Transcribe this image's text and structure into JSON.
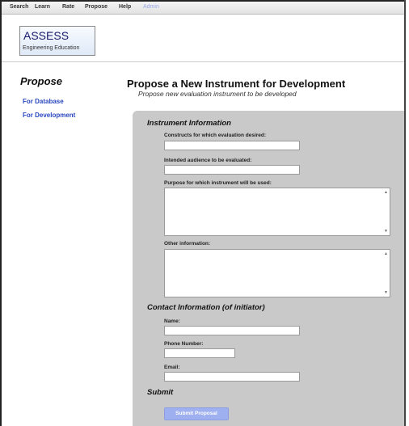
{
  "topnav": {
    "items": [
      "Search",
      "Learn",
      "Rate",
      "Propose",
      "Help"
    ],
    "admin": "Admin"
  },
  "logo": {
    "line1": "ASSESS",
    "line2": "Engineering Education"
  },
  "sidebar": {
    "title": "Propose",
    "links": [
      "For Database",
      "For Development"
    ]
  },
  "main": {
    "title": "Propose a New Instrument for Development",
    "subtitle": "Propose new evaluation instrument to be developed"
  },
  "form": {
    "instrument_section": "Instrument Information",
    "constructs_label": "Constructs for which evaluation desired:",
    "audience_label": "Intended audience to be evaluated:",
    "purpose_label": "Purpose for which instrument will be used:",
    "other_label": "Other information:",
    "contact_section": "Contact Information (of initiator)",
    "name_label": "Name:",
    "phone_label": "Phone Number:",
    "email_label": "Email:",
    "submit_section": "Submit",
    "submit_button": "Submit Proposal"
  },
  "colors": {
    "accent": "#9fb0f0",
    "link": "#2947c0",
    "panel": "#c9c9c9"
  }
}
